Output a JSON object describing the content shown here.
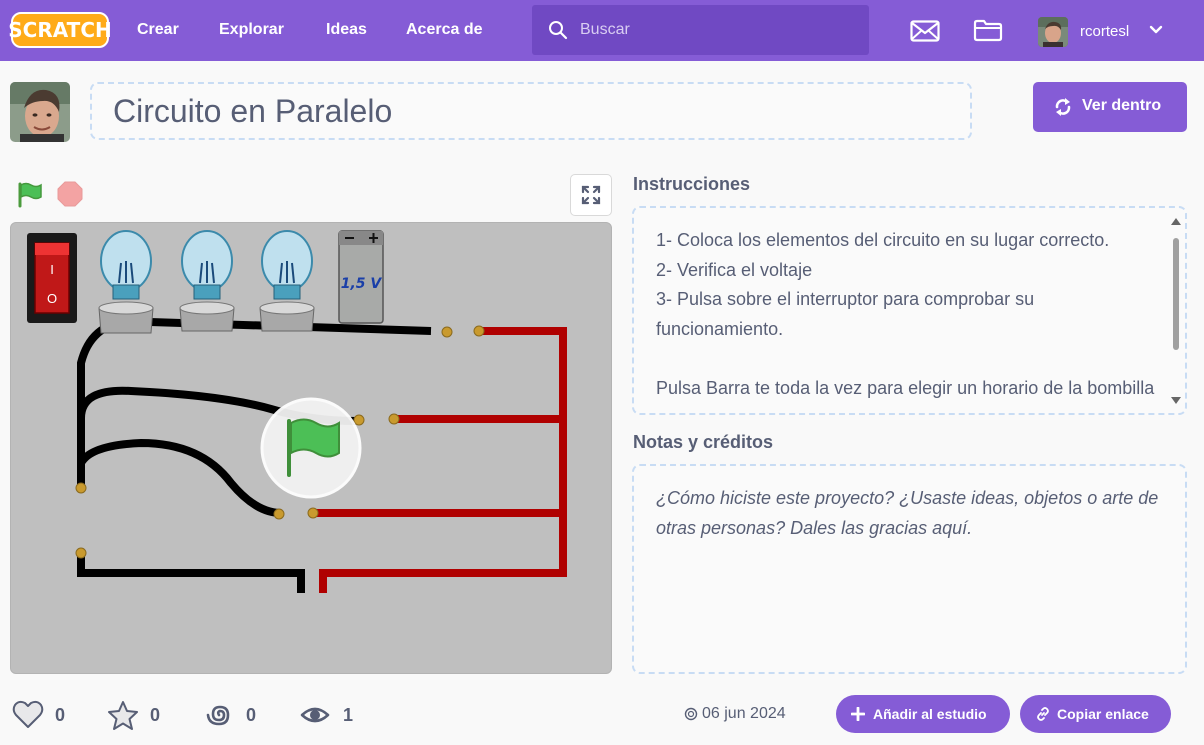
{
  "navbar": {
    "logo": "SCRATCH",
    "links": [
      "Crear",
      "Explorar",
      "Ideas",
      "Acerca de"
    ],
    "search_placeholder": "Buscar",
    "username": "rcortesl"
  },
  "project": {
    "title": "Circuito en Paralelo",
    "see_inside_label": "Ver dentro"
  },
  "stage": {
    "battery_label": "1,5 V",
    "switch_on": "I",
    "switch_off": "O"
  },
  "instructions": {
    "heading": "Instrucciones",
    "text": "1- Coloca los elementos del circuito en su lugar correcto.\n2- Verifica el voltaje\n3- Pulsa sobre el interruptor para comprobar su funcionamiento.\n\nPulsa Barra te toda la vez para elegir un horario de la bombilla"
  },
  "notes": {
    "heading": "Notas y créditos",
    "placeholder": "¿Cómo hiciste este proyecto? ¿Usaste ideas, objetos o arte de otras personas? Dales las gracias aquí."
  },
  "stats": {
    "loves": "0",
    "favorites": "0",
    "remixes": "0",
    "views": "1"
  },
  "footer": {
    "date": "06 jun 2024",
    "add_studio_label": "Añadir al estudio",
    "copy_link_label": "Copiar enlace"
  },
  "colors": {
    "brand": "#855cd6",
    "brand_dark": "#7049c3",
    "text": "#575e75",
    "wire_red": "#b00000",
    "wire_black": "#000000",
    "stage_bg": "#bfbfbf"
  }
}
